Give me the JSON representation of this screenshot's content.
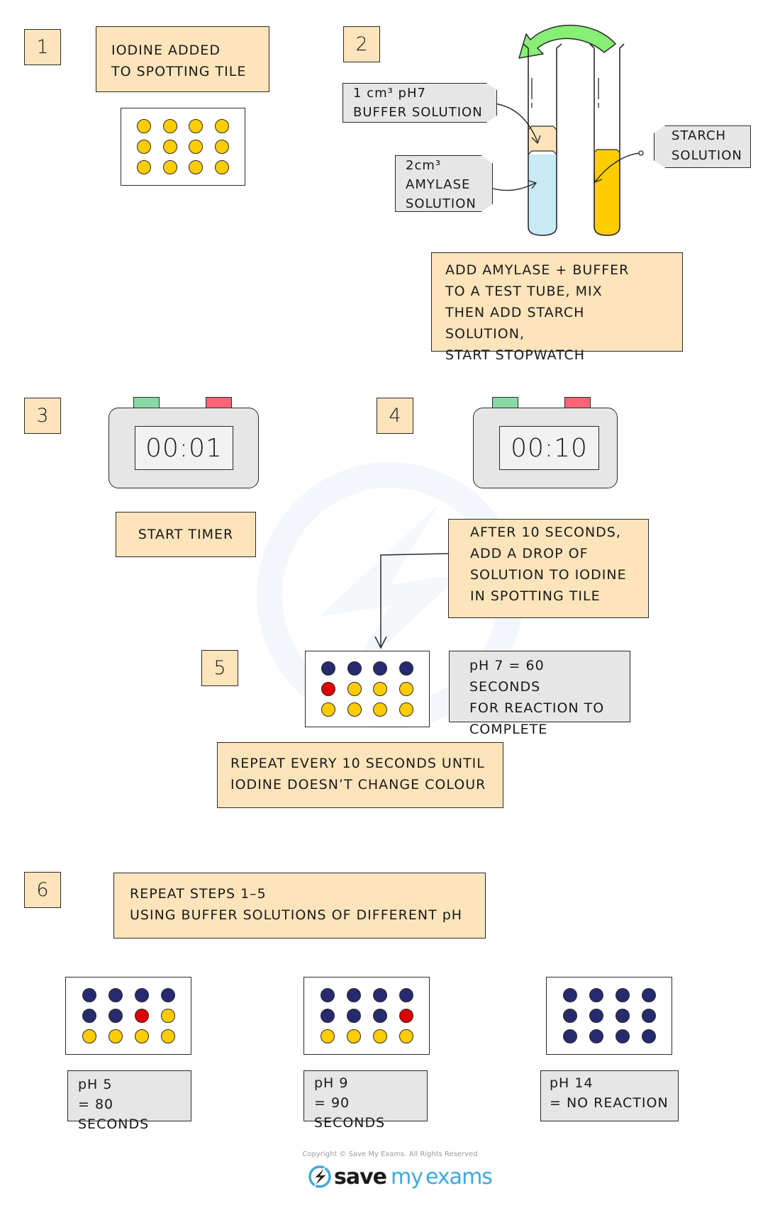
{
  "colors": {
    "note_fill": "#fde4bb",
    "label_fill": "#e6e6e6",
    "iodine_yellow": "#ffcc00",
    "starch_blue_black": "#262a6e",
    "red_intermediate": "#dd0000",
    "amylase_blue": "#c9e9f5",
    "buffer_tan": "#fde4bb",
    "arrow_green": "#86ef74",
    "timer_green": "#86dba4",
    "timer_red": "#ff6474",
    "brand_blue": "#3fa9e0"
  },
  "steps": [
    {
      "number": "1"
    },
    {
      "number": "2"
    },
    {
      "number": "3"
    },
    {
      "number": "4"
    },
    {
      "number": "5"
    },
    {
      "number": "6"
    }
  ],
  "step1": {
    "note": "IODINE  ADDED\nTO  SPOTTING  TILE",
    "tile": [
      "yellow",
      "yellow",
      "yellow",
      "yellow",
      "yellow",
      "yellow",
      "yellow",
      "yellow",
      "yellow",
      "yellow",
      "yellow",
      "yellow"
    ]
  },
  "step2": {
    "buffer_label": "1 cm³  pH7\nBUFFER  SOLUTION",
    "amylase_label": "2cm³\nAMYLASE\nSOLUTION",
    "starch_label": "STARCH\nSOLUTION",
    "note": "ADD  AMYLASE + BUFFER\nTO A TEST  TUBE, MIX\nTHEN  ADD  STARCH  SOLUTION,\nSTART   STOPWATCH"
  },
  "step3": {
    "timer_display": "00:01",
    "note": "START  TIMER"
  },
  "step4": {
    "timer_display": "00:10",
    "note": "AFTER  10  SECONDS,\nADD  A  DROP  OF\nSOLUTION  TO  IODINE\nIN  SPOTTING  TILE"
  },
  "step5": {
    "tile": [
      "blue",
      "blue",
      "blue",
      "blue",
      "red",
      "yellow",
      "yellow",
      "yellow",
      "yellow",
      "yellow",
      "yellow",
      "yellow"
    ],
    "result": "pH 7 = 60   SECONDS\nFOR  REACTION  TO\nCOMPLETE",
    "note": "REPEAT  EVERY  10  SECONDS  UNTIL\nIODINE  DOESN’T  CHANGE  COLOUR"
  },
  "step6": {
    "note": "REPEAT  STEPS  1–5\nUSING  BUFFER  SOLUTIONS  OF  DIFFERENT  pH",
    "results": [
      {
        "label": "pH 5\n= 80  SECONDS",
        "tile": [
          "blue",
          "blue",
          "blue",
          "blue",
          "blue",
          "blue",
          "red",
          "yellow",
          "yellow",
          "yellow",
          "yellow",
          "yellow"
        ]
      },
      {
        "label": "pH 9\n= 90  SECONDS",
        "tile": [
          "blue",
          "blue",
          "blue",
          "blue",
          "blue",
          "blue",
          "blue",
          "red",
          "yellow",
          "yellow",
          "yellow",
          "yellow"
        ]
      },
      {
        "label": "pH 14\n= NO  REACTION",
        "tile": [
          "blue",
          "blue",
          "blue",
          "blue",
          "blue",
          "blue",
          "blue",
          "blue",
          "blue",
          "blue",
          "blue",
          "blue"
        ]
      }
    ]
  },
  "footer": {
    "copyright": "Copyright © Save My Exams. All Rights Reserved",
    "brand_save": "save",
    "brand_my": "my",
    "brand_exams": "exams"
  }
}
